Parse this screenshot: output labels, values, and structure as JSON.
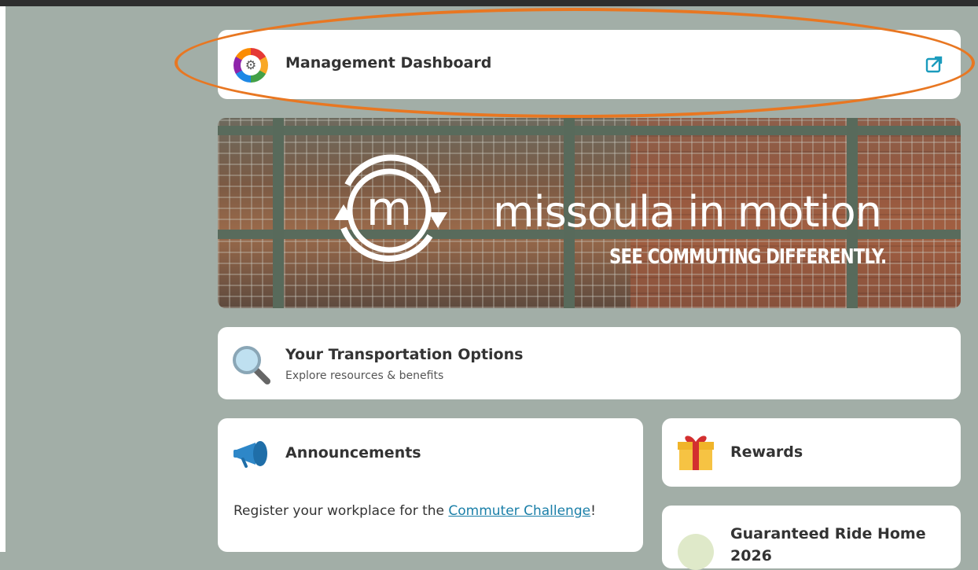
{
  "management": {
    "title": "Management Dashboard",
    "logo_icon": "dashboard-gear-icon",
    "external_icon": "external-link-icon",
    "accent_color": "#1a9bbd",
    "highlight_color": "#e87722"
  },
  "banner": {
    "brand": "missoula in motion",
    "tagline": "SEE COMMUTING DIFFERENTLY."
  },
  "transportation": {
    "title": "Your Transportation Options",
    "subtitle": "Explore resources & benefits",
    "icon": "magnifier-icon"
  },
  "announcements": {
    "title": "Announcements",
    "icon": "megaphone-icon",
    "text_before": "Register your workplace for the ",
    "link_text": "Commuter Challenge",
    "text_after": "!"
  },
  "rewards": {
    "title": "Rewards",
    "icon": "gift-icon"
  },
  "guaranteed_ride": {
    "title_line1": "Guaranteed Ride Home",
    "title_line2": "2026",
    "icon": "car-icon"
  }
}
